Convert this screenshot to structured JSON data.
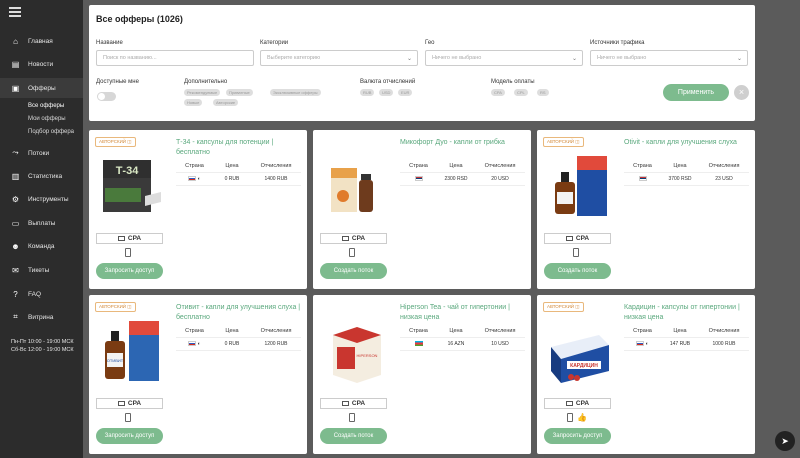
{
  "sidebar": {
    "items": [
      {
        "label": "Главная",
        "icon": "home-icon"
      },
      {
        "label": "Новости",
        "icon": "news-icon"
      },
      {
        "label": "Офферы",
        "icon": "offers-icon"
      },
      {
        "label": "Потоки",
        "icon": "flows-icon"
      },
      {
        "label": "Статистика",
        "icon": "stats-icon"
      },
      {
        "label": "Инструменты",
        "icon": "tools-icon"
      },
      {
        "label": "Выплаты",
        "icon": "payouts-icon"
      },
      {
        "label": "Команда",
        "icon": "team-icon"
      },
      {
        "label": "Тикеты",
        "icon": "tickets-icon"
      },
      {
        "label": "FAQ",
        "icon": "faq-icon"
      },
      {
        "label": "Витрина",
        "icon": "showcase-icon"
      }
    ],
    "subitems": [
      "Все офферы",
      "Мои офферы",
      "Подбор оффера"
    ],
    "schedule": [
      "Пн-Пт 10:00 - 19:00 МСК",
      "Сб-Вс 12:00 - 19:00 МСК"
    ]
  },
  "filters": {
    "title": "Все офферы (1026)",
    "name_label": "Название",
    "name_placeholder": "Поиск по названию...",
    "category_label": "Категории",
    "category_placeholder": "Выберите категорию",
    "geo_label": "Гео",
    "geo_placeholder": "Ничего не выбрано",
    "traffic_label": "Источники трафика",
    "traffic_placeholder": "Ничего не выбрано",
    "available_label": "Доступные мне",
    "extra_label": "Дополнительно",
    "extra_chips": [
      "Рекомендуемые",
      "Приватные",
      "Эксклюзивные офферы",
      "Новые",
      "Авторские"
    ],
    "currency_label": "Валюта отчислений",
    "currency_chips": [
      "RUB",
      "USD",
      "EUR"
    ],
    "model_label": "Модель оплаты",
    "model_chips": [
      "CPA",
      "CPL",
      "RS"
    ],
    "apply_label": "Применить",
    "clear_label": "×"
  },
  "table_headers": {
    "country": "Страна",
    "price": "Цена",
    "payout": "Отчисления"
  },
  "cards": [
    {
      "badge": "АВТОРСКИЙ",
      "title": "Т-34 - капсулы для потенции | бесплатно",
      "price": "0 RUB",
      "payout": "1400 RUB",
      "flag": "ru",
      "model": "CPA",
      "button": "Запросить доступ"
    },
    {
      "badge": "",
      "title": "Микофорт Дуо - капли от грибка",
      "price": "2300 RSD",
      "payout": "20 USD",
      "flag": "rs",
      "model": "CPA",
      "button": "Создать поток"
    },
    {
      "badge": "АВТОРСКИЙ",
      "title": "Otivit - капли для улучшения слуха",
      "price": "3700 RSD",
      "payout": "23 USD",
      "flag": "rs",
      "model": "CPA",
      "button": "Создать поток"
    },
    {
      "badge": "АВТОРСКИЙ",
      "title": "Отивит - капли для улучшения слуха | бесплатно",
      "price": "0 RUB",
      "payout": "1200 RUB",
      "flag": "ru",
      "model": "CPA",
      "button": "Запросить доступ"
    },
    {
      "badge": "",
      "title": "Hiperson Tea - чай от гипертонии | низкая цена",
      "price": "16 AZN",
      "payout": "10 USD",
      "flag": "az",
      "model": "CPA",
      "button": "Создать поток"
    },
    {
      "badge": "АВТОРСКИЙ",
      "title": "Кардицин - капсулы от гипертонии | низкая цена",
      "price": "147 RUB",
      "payout": "1000 RUB",
      "flag": "ru",
      "model": "CPA",
      "button": "Запросить доступ"
    }
  ],
  "product_texts": {
    "t34": "Т-34",
    "otivit": "ОТИВИТ",
    "hiperson": "HIPERSON",
    "kardicin": "КАРДИЦИН"
  }
}
